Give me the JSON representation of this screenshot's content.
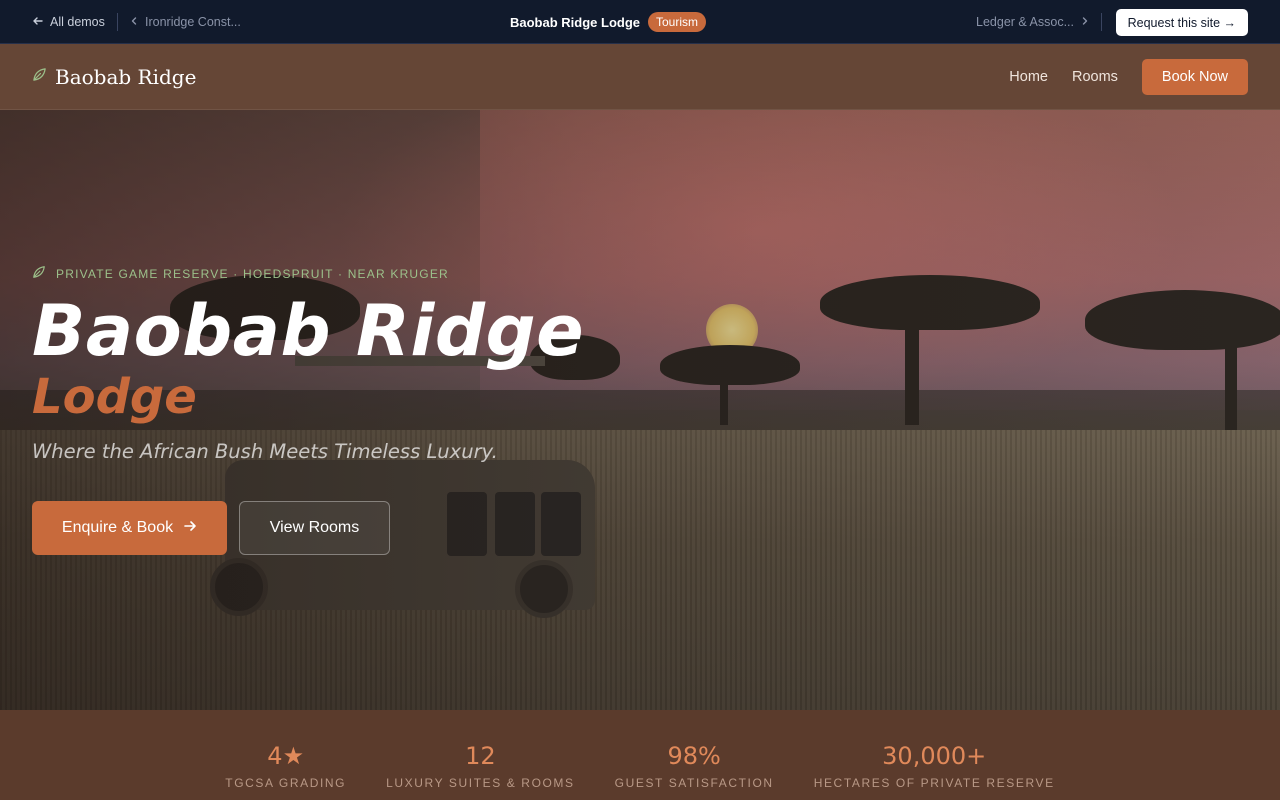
{
  "demo_bar": {
    "all_demos": "All demos",
    "prev_site": "Ironridge Const...",
    "site_title": "Baobab Ridge Lodge",
    "category_tag": "Tourism",
    "next_site": "Ledger & Assoc...",
    "request_button": "Request this site →"
  },
  "nav": {
    "brand": "Baobab Ridge",
    "links": [
      "Home",
      "Rooms"
    ],
    "book_button": "Book Now"
  },
  "hero": {
    "eyebrow": "PRIVATE GAME RESERVE · HOEDSPRUIT · NEAR KRUGER",
    "title_line1": "Baobab Ridge",
    "title_line2": "Lodge",
    "tagline": "Where the African Bush Meets Timeless Luxury.",
    "primary_button": "Enquire & Book",
    "secondary_button": "View Rooms"
  },
  "stats": [
    {
      "value": "4★",
      "label": "TGCSA GRADING"
    },
    {
      "value": "12",
      "label": "LUXURY SUITES & ROOMS"
    },
    {
      "value": "98%",
      "label": "GUEST SATISFACTION"
    },
    {
      "value": "30,000+",
      "label": "HECTARES OF PRIVATE RESERVE"
    }
  ],
  "colors": {
    "accent": "#c86a3c",
    "demo_bar_bg": "#111a2c",
    "nav_bg": "#654636",
    "stats_bg": "#5b3b2c",
    "eyebrow_green": "#9cc08a"
  }
}
